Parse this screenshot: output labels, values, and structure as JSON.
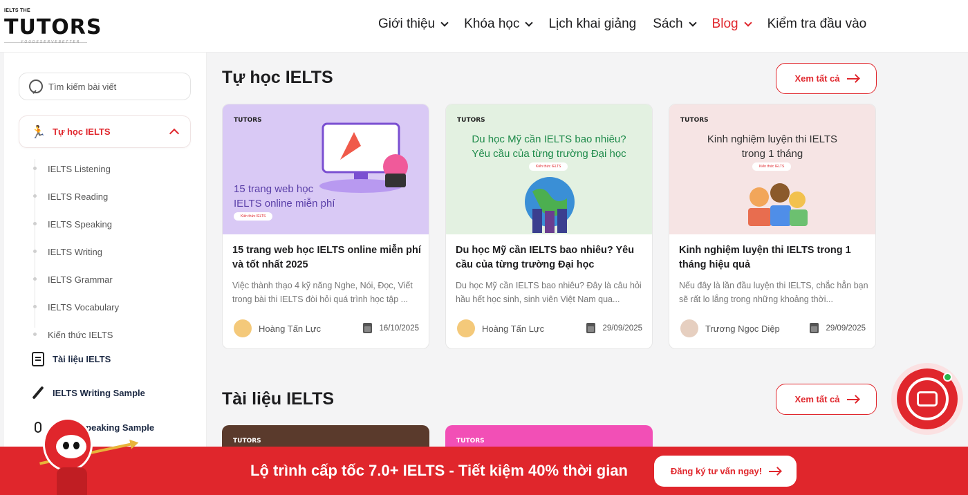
{
  "header": {
    "logo_small": "IELTS THE",
    "logo_big": "TUTORS",
    "logo_tagline": "YOUDESERVEBETTER",
    "nav": [
      {
        "label": "Giới thiệu",
        "has_dropdown": true,
        "active": false
      },
      {
        "label": "Khóa học",
        "has_dropdown": true,
        "active": false
      },
      {
        "label": "Lịch khai giảng",
        "has_dropdown": false,
        "active": false
      },
      {
        "label": "Sách",
        "has_dropdown": true,
        "active": false
      },
      {
        "label": "Blog",
        "has_dropdown": true,
        "active": true
      },
      {
        "label": "Kiểm tra đầu vào",
        "has_dropdown": false,
        "active": false
      }
    ]
  },
  "sidebar": {
    "search_placeholder": "Tìm kiếm bài viết",
    "active_category": "Tự học IELTS",
    "sub_items": [
      "IELTS Listening",
      "IELTS Reading",
      "IELTS Speaking",
      "IELTS Writing",
      "IELTS Grammar",
      "IELTS Vocabulary",
      "Kiến thức IELTS"
    ],
    "links": [
      {
        "label": "Tài liệu IELTS",
        "icon": "document-icon"
      },
      {
        "label": "IELTS Writing Sample",
        "icon": "pen-icon"
      },
      {
        "label": "IELTS Speaking Sample",
        "icon": "microphone-icon"
      }
    ]
  },
  "sections": [
    {
      "title": "Tự học IELTS",
      "view_all": "Xem tất cả"
    },
    {
      "title": "Tài liệu IELTS",
      "view_all": "Xem tất cả"
    }
  ],
  "cards": [
    {
      "thumb_logo": "TUTORS",
      "thumb_text": "15 trang web học\nIELTS online miễn phí",
      "thumb_pill": "Kiến thức IELTS",
      "thumb_bg": "#d9c9f5",
      "title": "15 trang web học IELTS online miễn phí và tốt nhất 2025",
      "excerpt": "Việc thành thạo 4 kỹ năng Nghe, Nói, Đọc, Viết trong bài thi IELTS đòi hỏi quá trình học tập ...",
      "author": "Hoàng Tấn Lực",
      "date": "16/10/2025"
    },
    {
      "thumb_logo": "TUTORS",
      "thumb_text": "Du học Mỹ cần IELTS bao nhiêu?\nYêu cầu của từng trường Đại học",
      "thumb_pill": "Kiến thức IELTS",
      "thumb_bg": "#e3f1e1",
      "title": "Du học Mỹ cần IELTS bao nhiêu? Yêu cầu của từng trường Đại học",
      "excerpt": "Du học Mỹ cần IELTS bao nhiêu? Đây là câu hỏi hầu hết học sinh, sinh viên Việt Nam qua...",
      "author": "Hoàng Tấn Lực",
      "date": "29/09/2025"
    },
    {
      "thumb_logo": "TUTORS",
      "thumb_text": "Kinh nghiệm luyện thi IELTS\ntrong 1 tháng",
      "thumb_pill": "Kiến thức IELTS",
      "thumb_bg": "#f6e4e4",
      "title": "Kinh nghiệm luyện thi IELTS trong 1 tháng hiệu quả",
      "excerpt": "Nếu đây là lần đầu luyện thi IELTS, chắc hẳn bạn sẽ rất lo lắng trong những khoảng thời...",
      "author": "Trương Ngọc Diệp",
      "date": "29/09/2025"
    }
  ],
  "second_row_logos": [
    "TUTORS",
    "TUTORS"
  ],
  "promo": {
    "text": "Lộ trình cấp tốc 7.0+ IELTS - Tiết kiệm 40% thời gian",
    "button": "Đăng ký tư vấn ngay!"
  },
  "colors": {
    "accent": "#e0262c",
    "online": "#2ab54b"
  }
}
